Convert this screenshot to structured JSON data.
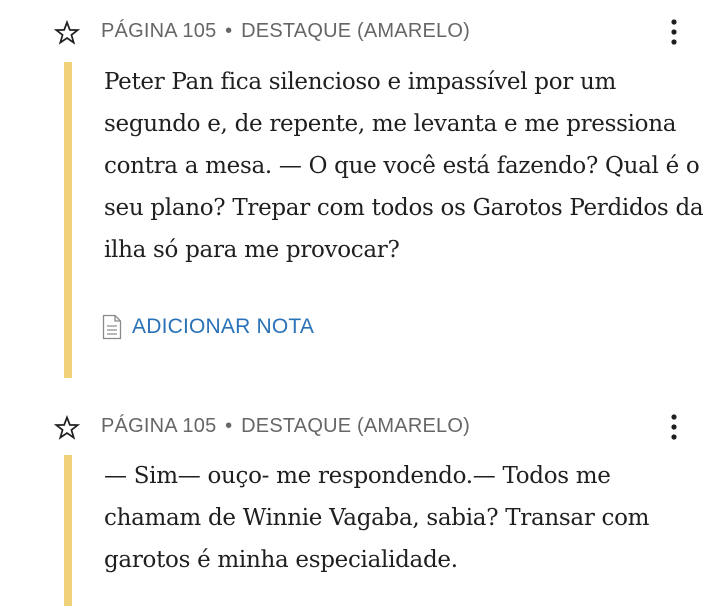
{
  "colors": {
    "accent_yellow": "#efd27a",
    "meta_gray": "#666666",
    "link_blue": "#2a72b8",
    "text": "#1f1f1f"
  },
  "highlights": [
    {
      "star_icon": "star-outline-icon",
      "page_label": "PÁGINA 105",
      "separator": "•",
      "type_label": "DESTAQUE (AMARELO)",
      "more_icon": "vertical-ellipsis-icon",
      "text": "Peter Pan fica silencioso e impassível por um segundo e, de repente, me levanta e me pressiona contra a mesa. — O que você está fazendo? Qual é o seu plano? Trepar com todos os Garotos Perdidos da ilha só para me provocar?",
      "add_note_icon": "note-page-icon",
      "add_note_label": "ADICIONAR NOTA"
    },
    {
      "star_icon": "star-outline-icon",
      "page_label": "PÁGINA 105",
      "separator": "•",
      "type_label": "DESTAQUE (AMARELO)",
      "more_icon": "vertical-ellipsis-icon",
      "text": "— Sim— ouço- me respondendo.— Todos me chamam de Winnie Vagaba, sabia? Transar com garotos é minha especialidade."
    }
  ]
}
